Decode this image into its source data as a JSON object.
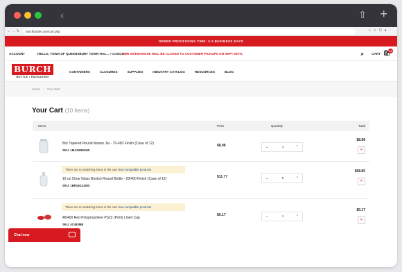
{
  "browser": {
    "url": "burchbottle.com/cart.php"
  },
  "promo": {
    "text": "ORDER PROCESSING TIME: 2-3 BUSINESS DAYS"
  },
  "topbar": {
    "account": "ACCOUNT",
    "hello": "HELLO, TOWN OF QUEENSBURY TOWN HAL... ˅",
    "logout": "LOGOUT",
    "notice": "OUR WAREHOUSE WILL BE CLOSED TO CUSTOMER PICKUPS ON SEPT 25TH.",
    "cart_label": "CART",
    "cart_count": "10"
  },
  "logo": {
    "name": "BURCH",
    "tagline": "BOTTLE • PACKAGING"
  },
  "nav": [
    "CONTAINERS",
    "CLOSURES",
    "SUPPLIES",
    "INDUSTRY CATALOG",
    "RESOURCES",
    "BLOG"
  ],
  "breadcrumb": {
    "home": "Home",
    "current": "Your Cart"
  },
  "cart": {
    "title": "Your Cart",
    "count": "(10 items)",
    "headers": {
      "items": "Items",
      "price": "Price",
      "quantity": "Quantity",
      "total": "Total"
    },
    "note_text": "There are no matching items in the cart",
    "note_link": "view compatible products",
    "rows": [
      {
        "name": "8oz Tapered Round Mason Jar - 70-450 Finish (Case of 12)",
        "sku": "SKU: 1MAS0R8SHD",
        "price": "$8.98",
        "qty": "1",
        "total": "$8.98"
      },
      {
        "name": "16 oz Clear Glass Boston Round Bottle - 28/400 Finish (Case of 12)",
        "sku": "SKU: 1BR16G2150C",
        "price": "$11.77",
        "qty": "5",
        "total": "$58.85"
      },
      {
        "name": "48/400 Red Polypropylene PS22 (Print) Lined Cap",
        "sku": "SKU: 4C483MB",
        "price": "$0.17",
        "qty": "1",
        "total": "$0.17"
      }
    ]
  },
  "chat": {
    "label": "Chat now"
  }
}
